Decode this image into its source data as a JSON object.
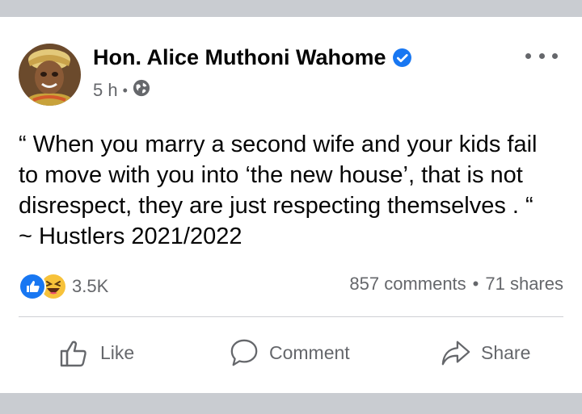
{
  "post": {
    "author": "Hon. Alice Muthoni Wahome",
    "verified": true,
    "time": "5 h",
    "audience_icon": "globe-icon",
    "text_lines": [
      "“ When you marry a second wife and your kids fail",
      "to move with you into ‘the new house’, that is not",
      "disrespect, they are just respecting themselves . “",
      "~ Hustlers 2021/2022"
    ]
  },
  "reactions": {
    "icons": [
      "like-reaction-icon",
      "haha-reaction-icon"
    ],
    "count": "3.5K"
  },
  "stats": {
    "comments": "857 comments",
    "separator": "•",
    "shares": "71 shares"
  },
  "actions": {
    "like": "Like",
    "comment": "Comment",
    "share": "Share"
  },
  "colors": {
    "accent": "#1877f2",
    "secondary_text": "#65676b",
    "primary_text": "#050505",
    "divider": "#ced0d4"
  }
}
